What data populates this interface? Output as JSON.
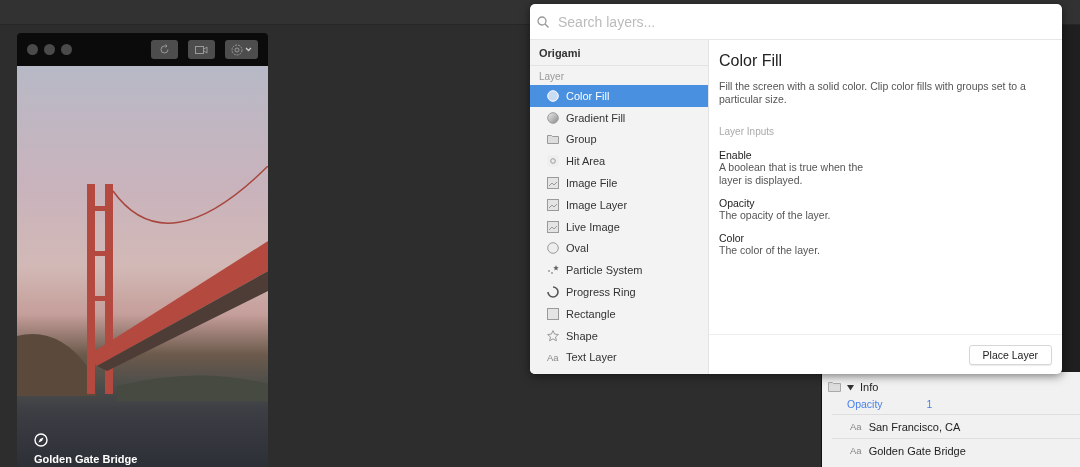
{
  "viewer": {
    "caption": "Golden Gate Bridge"
  },
  "popover": {
    "search": {
      "placeholder": "Search layers..."
    },
    "library": "Origami",
    "section": "Layer",
    "items": [
      {
        "label": "Color Fill",
        "kind": "circle",
        "selected": true
      },
      {
        "label": "Gradient Fill",
        "kind": "gradient",
        "selected": false
      },
      {
        "label": "Group",
        "kind": "folder",
        "selected": false
      },
      {
        "label": "Hit Area",
        "kind": "hit",
        "selected": false
      },
      {
        "label": "Image File",
        "kind": "image",
        "selected": false
      },
      {
        "label": "Image Layer",
        "kind": "image",
        "selected": false
      },
      {
        "label": "Live Image",
        "kind": "image",
        "selected": false
      },
      {
        "label": "Oval",
        "kind": "oval",
        "selected": false
      },
      {
        "label": "Particle System",
        "kind": "particle",
        "selected": false
      },
      {
        "label": "Progress Ring",
        "kind": "ring",
        "selected": false
      },
      {
        "label": "Rectangle",
        "kind": "rect",
        "selected": false
      },
      {
        "label": "Shape",
        "kind": "star",
        "selected": false
      },
      {
        "label": "Text Layer",
        "kind": "text",
        "icon_text": "Aa",
        "selected": false
      }
    ],
    "detail": {
      "title": "Color Fill",
      "description": "Fill the screen with a solid color. Clip color fills with groups set to a particular size.",
      "inputs_heading": "Layer Inputs",
      "inputs": [
        {
          "name": "Enable",
          "description": "A boolean that is true when the layer is displayed."
        },
        {
          "name": "Opacity",
          "description": "The opacity of the layer."
        },
        {
          "name": "Color",
          "description": "The color of the layer."
        }
      ]
    },
    "button": "Place Layer"
  },
  "layers_panel": {
    "group": {
      "name": "Info",
      "expanded": true,
      "property": {
        "name": "Opacity",
        "value": "1"
      }
    },
    "rows": [
      {
        "icon_text": "Aa",
        "label": "San Francisco, CA"
      },
      {
        "icon_text": "Aa",
        "label": "Golden Gate Bridge"
      }
    ]
  }
}
